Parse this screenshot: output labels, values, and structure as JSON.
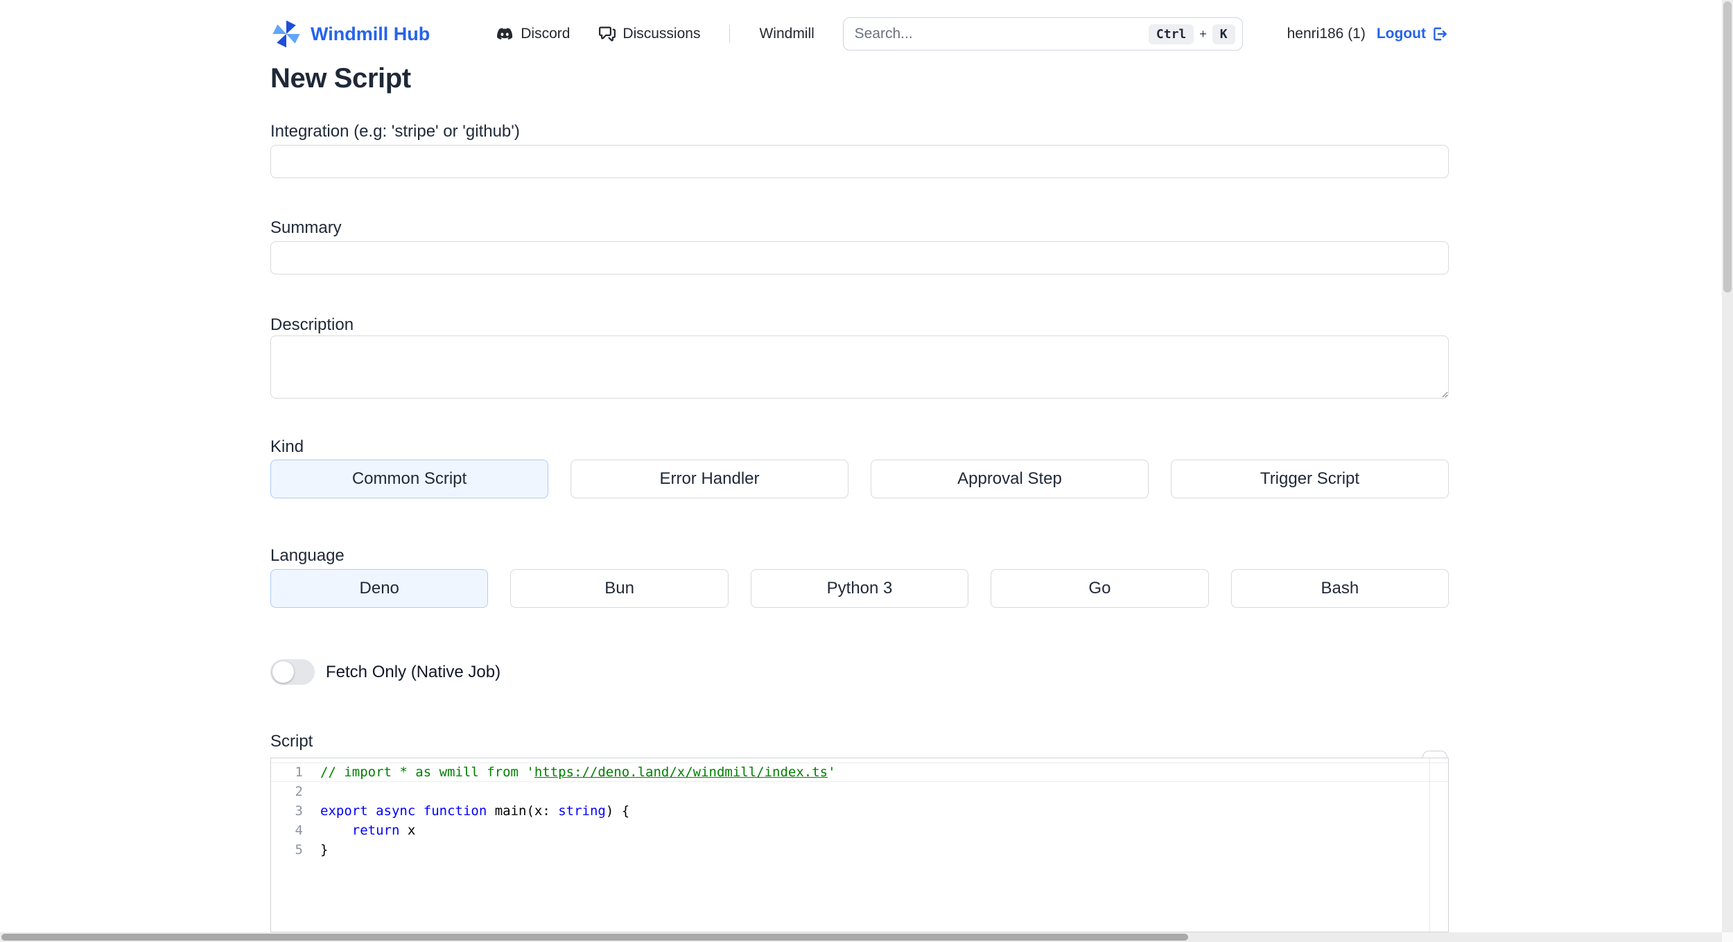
{
  "colors": {
    "accent": "#2563eb",
    "selected_bg": "#eff6ff",
    "selected_border": "#aecbfa",
    "comment_green": "#008000",
    "keyword_blue": "#0000ff"
  },
  "header": {
    "brand": "Windmill Hub",
    "nav": {
      "discord": "Discord",
      "discussions": "Discussions",
      "windmill": "Windmill"
    },
    "search": {
      "placeholder": "Search...",
      "key_ctrl": "Ctrl",
      "key_plus": "+",
      "key_k": "K"
    },
    "user": "henri186 (1)",
    "logout": "Logout"
  },
  "page": {
    "title": "New Script",
    "integration": {
      "label": "Integration (e.g: 'stripe' or 'github')",
      "value": ""
    },
    "summary": {
      "label": "Summary",
      "value": ""
    },
    "description": {
      "label": "Description",
      "value": ""
    },
    "kind": {
      "label": "Kind",
      "options": [
        "Common Script",
        "Error Handler",
        "Approval Step",
        "Trigger Script"
      ],
      "selected": "Common Script"
    },
    "language": {
      "label": "Language",
      "options": [
        "Deno",
        "Bun",
        "Python 3",
        "Go",
        "Bash"
      ],
      "selected": "Deno"
    },
    "fetch_only": {
      "label": "Fetch Only (Native Job)",
      "enabled": false
    },
    "script": {
      "label": "Script",
      "code_lines": [
        {
          "number": "1",
          "active": true,
          "tokens": [
            {
              "t": "// import * as wmill from '",
              "c": "comment"
            },
            {
              "t": "https://deno.land/x/windmill/index.ts",
              "c": "comment-link"
            },
            {
              "t": "'",
              "c": "comment"
            }
          ]
        },
        {
          "number": "2",
          "tokens": []
        },
        {
          "number": "3",
          "tokens": [
            {
              "t": "export",
              "c": "keyword"
            },
            {
              "t": " ",
              "c": "plain"
            },
            {
              "t": "async",
              "c": "keyword"
            },
            {
              "t": " ",
              "c": "plain"
            },
            {
              "t": "function",
              "c": "keyword"
            },
            {
              "t": " main(x: ",
              "c": "plain"
            },
            {
              "t": "string",
              "c": "keyword"
            },
            {
              "t": ") {",
              "c": "plain"
            }
          ]
        },
        {
          "number": "4",
          "tokens": [
            {
              "t": "    ",
              "c": "plain"
            },
            {
              "t": "return",
              "c": "keyword"
            },
            {
              "t": " x",
              "c": "plain"
            }
          ]
        },
        {
          "number": "5",
          "tokens": [
            {
              "t": "}",
              "c": "plain"
            }
          ]
        }
      ]
    }
  }
}
